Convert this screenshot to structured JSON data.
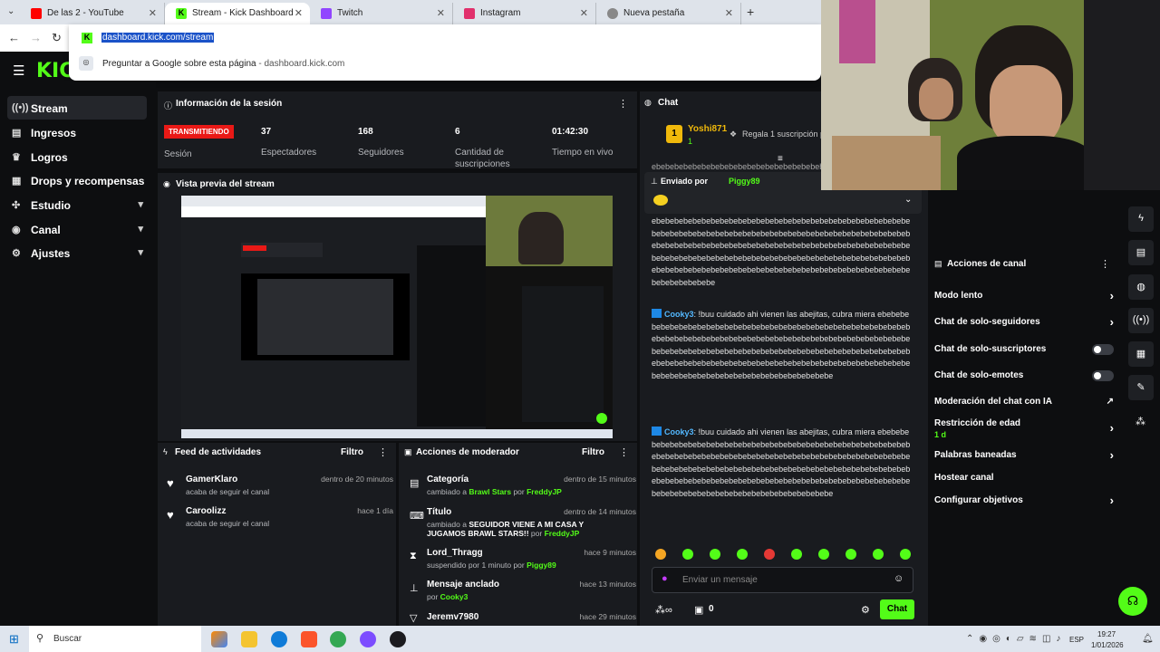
{
  "browser": {
    "tabs": [
      {
        "title": "De las 2 - YouTube"
      },
      {
        "title": "Stream - Kick Dashboard"
      },
      {
        "title": "Twitch"
      },
      {
        "title": "Instagram"
      },
      {
        "title": "Nueva pestaña"
      }
    ],
    "url": "dashboard.kick.com/stream",
    "suggestion": "Preguntar a Google sobre esta página",
    "suggestion_url": " - dashboard.kick.com"
  },
  "sidebar": {
    "items": [
      {
        "label": "Stream"
      },
      {
        "label": "Ingresos"
      },
      {
        "label": "Logros"
      },
      {
        "label": "Drops y recompensas"
      },
      {
        "label": "Estudio"
      },
      {
        "label": "Canal"
      },
      {
        "label": "Ajustes"
      }
    ]
  },
  "session": {
    "title": "Información de la sesión",
    "badge": "TRANSMITIENDO",
    "badge_label": "Sesión",
    "stats": [
      {
        "value": "37",
        "label": "Espectadores"
      },
      {
        "value": "168",
        "label": "Seguidores"
      },
      {
        "value": "6",
        "label": "Cantidad de suscripciones"
      },
      {
        "value": "01:42:30",
        "label": "Tiempo en vivo"
      }
    ]
  },
  "preview": {
    "title": "Vista previa del stream"
  },
  "feed": {
    "title": "Feed de actividades",
    "filter": "Filtro",
    "items": [
      {
        "name": "GamerKlaro",
        "action": "acaba de seguir el canal",
        "time": "dentro de 20 minutos"
      },
      {
        "name": "Caroolizz",
        "action": "acaba de seguir el canal",
        "time": "hace 1 día"
      }
    ]
  },
  "mod": {
    "title": "Acciones de moderador",
    "filter": "Filtro",
    "items": [
      {
        "title": "Categoría",
        "pre": "cambiado a ",
        "val": "Brawl Stars",
        "mid": " por ",
        "user": "FreddyJP",
        "time": "dentro de 15 minutos"
      },
      {
        "title": "Título",
        "pre": "cambiado a ",
        "val": "SEGUIDOR VIENE A MI CASA Y JUGAMOS BRAWL STARS!!",
        "mid": " por ",
        "user": "FreddyJP",
        "time": "dentro de 14 minutos"
      },
      {
        "title": "Lord_Thragg",
        "pre": "suspendido por 1 minuto por ",
        "val": "",
        "mid": "",
        "user": "Piggy89",
        "time": "hace 9 minutos"
      },
      {
        "title": "Mensaje anclado",
        "pre": "por ",
        "val": "",
        "mid": "",
        "user": "Cooky3",
        "time": "hace 13 minutos"
      },
      {
        "title": "Jeremv7980",
        "pre": "",
        "val": "",
        "mid": "",
        "user": "",
        "time": "hace 29 minutos"
      }
    ]
  },
  "chat": {
    "title": "Chat",
    "top_user": "Yoshi871",
    "top_rank": "1",
    "top_count": "1",
    "gift": "Regala 1 suscripción p",
    "pinned_by": "Enviado por",
    "pinned_user": "Piggy89",
    "spam_short": "ebebebebebebebebebebebebebebebebebebebebebebebebebebebebebebebebebebebebebebebebebebebebebebebebebebebebebebebebebebebebebebebebebebebebebebebebebebebebebebebebebebebebebebebebebebebebebebebebebebebebebebebebebebebebebebebebebebebebebebebebebebebebebebebebebebebebebebebebebebebebebebebebebebebebebe",
    "msg_user": "Cooky3",
    "msg_text": ": !buu cuidado ahi vienen las abejitas, cubra miera ebebebebebebebebebebebebebebebebebebebebebebebebebebebebebebebebebebebebebebebebebebebebebebebebebebebebebebebebebebebebebebebebebebebebebebebebebebebebebebebebebebebebebebebebebebebebebebebebebebebebebebebebebebebebebebebebebebebebebebebebebebebebebebebebebebebebebebebebebe",
    "placeholder": "Enviar un mensaje",
    "count": "0",
    "send": "Chat"
  },
  "actions": {
    "title": "Acciones de canal",
    "items": [
      {
        "label": "Modo lento",
        "kind": "chevron",
        "sub": ""
      },
      {
        "label": "Chat de solo-seguidores",
        "kind": "chevron",
        "sub": ""
      },
      {
        "label": "Chat de solo-suscriptores",
        "kind": "toggle",
        "sub": ""
      },
      {
        "label": "Chat de solo-emotes",
        "kind": "toggle",
        "sub": ""
      },
      {
        "label": "Moderación del chat con IA",
        "kind": "external",
        "sub": ""
      },
      {
        "label": "Restricción de edad",
        "kind": "chevron",
        "sub": "1 d"
      },
      {
        "label": "Palabras baneadas",
        "kind": "chevron",
        "sub": ""
      },
      {
        "label": "Hostear canal",
        "kind": "none",
        "sub": ""
      },
      {
        "label": "Configurar objetivos",
        "kind": "chevron",
        "sub": ""
      }
    ]
  },
  "taskbar": {
    "search": "Buscar",
    "lang": "ESP",
    "time": "19:27",
    "date": "1/01/2026"
  },
  "colors": {
    "accent": "#53fc18",
    "badge": "#e91916",
    "bg": "#0d0e10",
    "panel": "#191b1f"
  }
}
